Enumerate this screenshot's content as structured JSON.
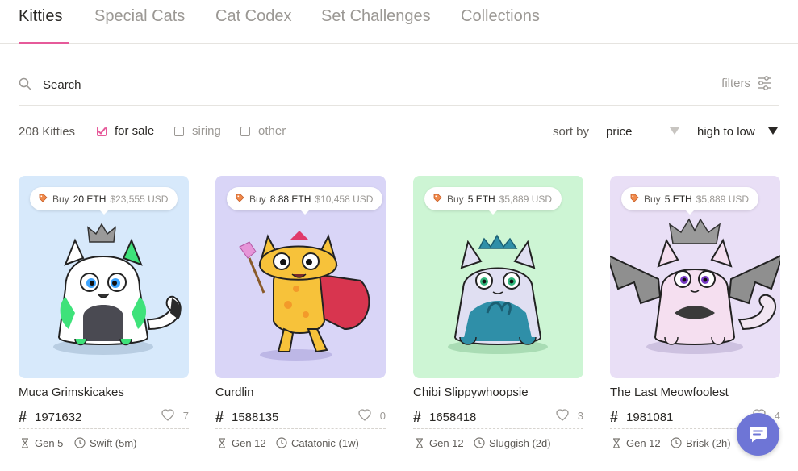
{
  "tabs": [
    {
      "label": "Kitties",
      "active": true
    },
    {
      "label": "Special Cats"
    },
    {
      "label": "Cat Codex"
    },
    {
      "label": "Set Challenges"
    },
    {
      "label": "Collections"
    }
  ],
  "search": {
    "placeholder": "Search",
    "filters_label": "filters"
  },
  "controls": {
    "count": "208 Kitties",
    "checkboxes": [
      {
        "label": "for sale",
        "checked": true
      },
      {
        "label": "siring",
        "checked": false
      },
      {
        "label": "other",
        "checked": false
      }
    ],
    "sort_by_label": "sort by",
    "sort_value": "price",
    "order_value": "high to low"
  },
  "kitties": [
    {
      "buy": "Buy",
      "eth": "20 ETH",
      "usd": "$23,555 USD",
      "name": "Muca Grimskicakes",
      "id": "1971632",
      "likes": "7",
      "gen": "Gen 5",
      "speed": "Swift (5m)",
      "bg": "#d7e9fb"
    },
    {
      "buy": "Buy",
      "eth": "8.88 ETH",
      "usd": "$10,458 USD",
      "name": "Curdlin",
      "id": "1588135",
      "likes": "0",
      "gen": "Gen 12",
      "speed": "Catatonic (1w)",
      "bg": "#d9d5f7"
    },
    {
      "buy": "Buy",
      "eth": "5 ETH",
      "usd": "$5,889 USD",
      "name": "Chibi Slippywhoopsie",
      "id": "1658418",
      "likes": "3",
      "gen": "Gen 12",
      "speed": "Sluggish (2d)",
      "bg": "#cdf5d4"
    },
    {
      "buy": "Buy",
      "eth": "5 ETH",
      "usd": "$5,889 USD",
      "name": "The Last Meowfoolest",
      "id": "1981081",
      "likes": "4",
      "gen": "Gen 12",
      "speed": "Brisk (2h)",
      "bg": "#e9dff6"
    }
  ],
  "colors": {
    "accent": "#e65a9a",
    "chat": "#6e75d6"
  },
  "icons": {
    "search": "search-icon",
    "filters": "sliders-icon",
    "price_tag": "tag-icon",
    "heart": "heart-icon",
    "gen": "hourglass-icon",
    "cooldown": "clock-icon",
    "chat": "chat-icon"
  }
}
